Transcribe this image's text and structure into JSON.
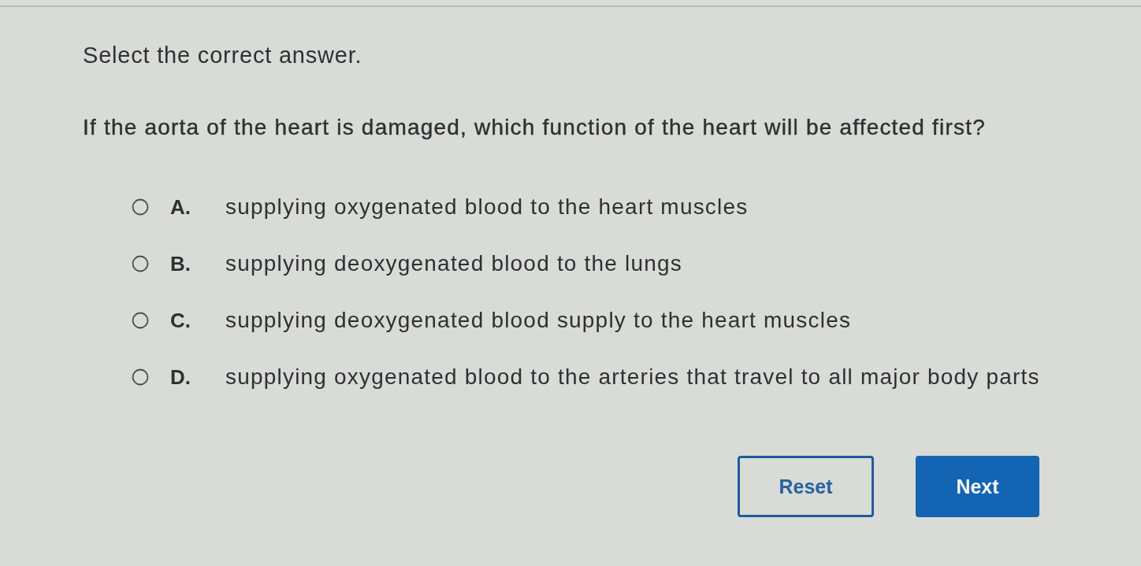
{
  "instruction": "Select the correct answer.",
  "question": "If the aorta of the heart is damaged, which function of the heart will be affected first?",
  "options": [
    {
      "letter": "A.",
      "text": "supplying oxygenated blood to the heart muscles",
      "selected": false
    },
    {
      "letter": "B.",
      "text": "supplying deoxygenated blood to the lungs",
      "selected": false
    },
    {
      "letter": "C.",
      "text": "supplying deoxygenated blood supply to the heart muscles",
      "selected": false
    },
    {
      "letter": "D.",
      "text": "supplying oxygenated blood to the arteries that travel to all major body parts",
      "selected": false
    }
  ],
  "buttons": [
    {
      "label": "Reset",
      "kind": "secondary"
    },
    {
      "label": "Next",
      "kind": "primary"
    }
  ]
}
